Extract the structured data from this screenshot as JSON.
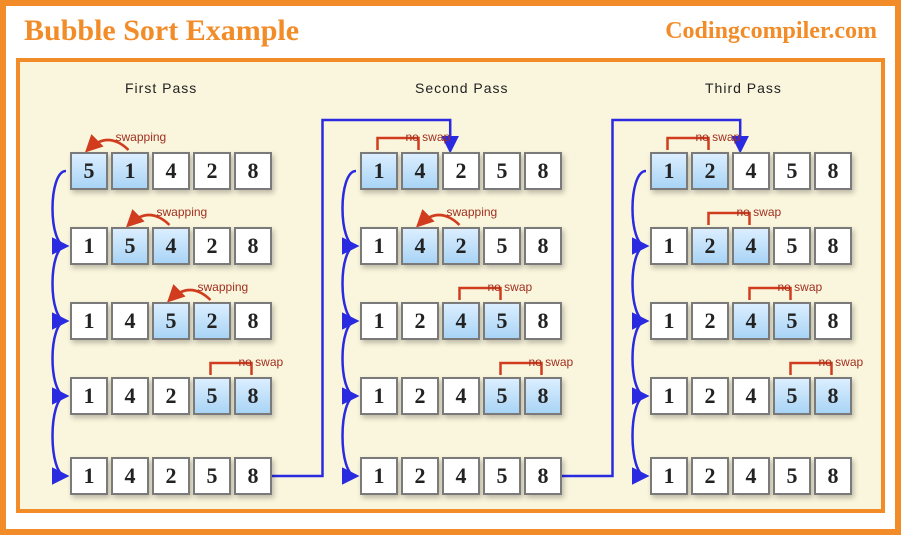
{
  "header": {
    "title": "Bubble Sort Example",
    "site": "Codingcompiler.com"
  },
  "labels": {
    "swapping": "swapping",
    "noswap": "no swap"
  },
  "passes": [
    {
      "title": "First  Pass",
      "steps": [
        {
          "values": [
            5,
            1,
            4,
            2,
            8
          ],
          "highlight": [
            0,
            1
          ],
          "note": "swapping"
        },
        {
          "values": [
            1,
            5,
            4,
            2,
            8
          ],
          "highlight": [
            1,
            2
          ],
          "note": "swapping"
        },
        {
          "values": [
            1,
            4,
            5,
            2,
            8
          ],
          "highlight": [
            2,
            3
          ],
          "note": "swapping"
        },
        {
          "values": [
            1,
            4,
            2,
            5,
            8
          ],
          "highlight": [
            3,
            4
          ],
          "note": "no swap"
        },
        {
          "values": [
            1,
            4,
            2,
            5,
            8
          ],
          "highlight": [],
          "note": ""
        }
      ]
    },
    {
      "title": "Second  Pass",
      "steps": [
        {
          "values": [
            1,
            4,
            2,
            5,
            8
          ],
          "highlight": [
            0,
            1
          ],
          "note": "no swap"
        },
        {
          "values": [
            1,
            4,
            2,
            5,
            8
          ],
          "highlight": [
            1,
            2
          ],
          "note": "swapping"
        },
        {
          "values": [
            1,
            2,
            4,
            5,
            8
          ],
          "highlight": [
            2,
            3
          ],
          "note": "no swap"
        },
        {
          "values": [
            1,
            2,
            4,
            5,
            8
          ],
          "highlight": [
            3,
            4
          ],
          "note": "no swap"
        },
        {
          "values": [
            1,
            2,
            4,
            5,
            8
          ],
          "highlight": [],
          "note": ""
        }
      ]
    },
    {
      "title": "Third  Pass",
      "steps": [
        {
          "values": [
            1,
            2,
            4,
            5,
            8
          ],
          "highlight": [
            0,
            1
          ],
          "note": "no swap"
        },
        {
          "values": [
            1,
            2,
            4,
            5,
            8
          ],
          "highlight": [
            1,
            2
          ],
          "note": "no swap"
        },
        {
          "values": [
            1,
            2,
            4,
            5,
            8
          ],
          "highlight": [
            2,
            3
          ],
          "note": "no swap"
        },
        {
          "values": [
            1,
            2,
            4,
            5,
            8
          ],
          "highlight": [
            3,
            4
          ],
          "note": "no swap"
        },
        {
          "values": [
            1,
            2,
            4,
            5,
            8
          ],
          "highlight": [],
          "note": ""
        }
      ]
    }
  ]
}
